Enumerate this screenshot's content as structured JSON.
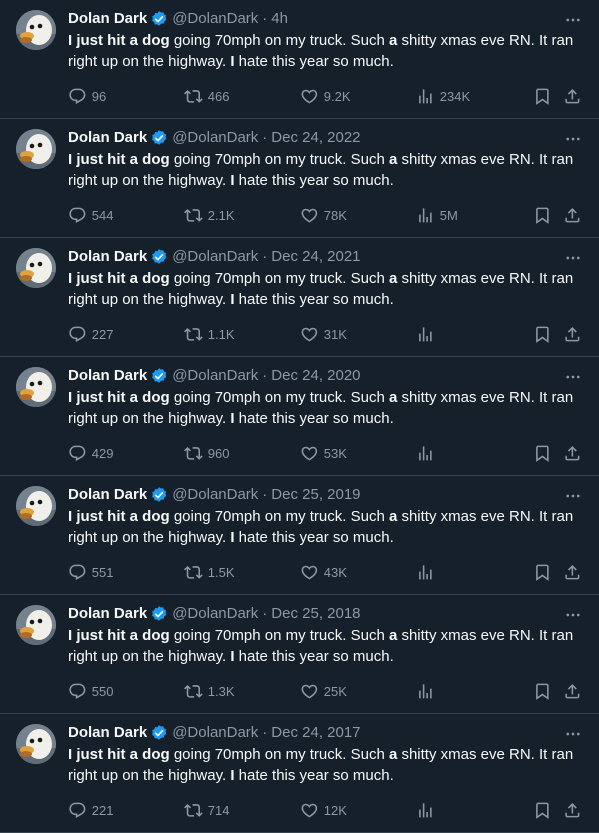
{
  "account": {
    "name": "Dolan Dark",
    "handle": "@DolanDark"
  },
  "tweet_text": {
    "p1": "I just hit a dog",
    "p2": " going 70mph on my truck. Such ",
    "p3": "a",
    "p4": " shitty xmas eve RN. It ran right up on the highway. ",
    "p5": "I",
    "p6": " hate this year so much."
  },
  "separator": "·",
  "tweets": [
    {
      "time": "4h",
      "replies": "96",
      "retweets": "466",
      "likes": "9.2K",
      "views": "234K"
    },
    {
      "time": "Dec 24, 2022",
      "replies": "544",
      "retweets": "2.1K",
      "likes": "78K",
      "views": "5M"
    },
    {
      "time": "Dec 24, 2021",
      "replies": "227",
      "retweets": "1.1K",
      "likes": "31K",
      "views": ""
    },
    {
      "time": "Dec 24, 2020",
      "replies": "429",
      "retweets": "960",
      "likes": "53K",
      "views": ""
    },
    {
      "time": "Dec 25, 2019",
      "replies": "551",
      "retweets": "1.5K",
      "likes": "43K",
      "views": ""
    },
    {
      "time": "Dec 25, 2018",
      "replies": "550",
      "retweets": "1.3K",
      "likes": "25K",
      "views": ""
    },
    {
      "time": "Dec 24, 2017",
      "replies": "221",
      "retweets": "714",
      "likes": "12K",
      "views": ""
    }
  ],
  "icons": {
    "more": "more-icon",
    "verified": "verified-badge-icon",
    "reply": "reply-icon",
    "retweet": "retweet-icon",
    "like": "heart-icon",
    "views": "views-icon",
    "bookmark": "bookmark-icon",
    "share": "share-icon"
  },
  "colors": {
    "background": "#15202b",
    "divider": "#38444d",
    "primary_text": "#f7f9f9",
    "secondary_text": "#8b98a5",
    "verified": "#1d9bf0"
  }
}
